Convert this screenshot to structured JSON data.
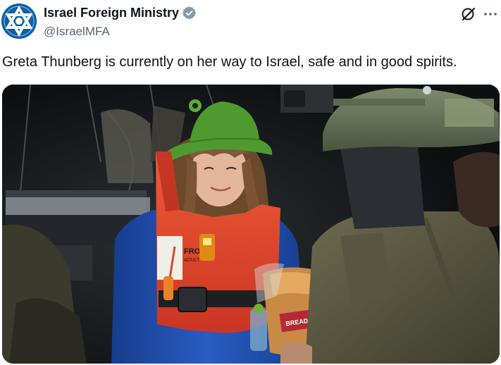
{
  "account": {
    "display_name": "Israel Foreign Ministry",
    "handle": "@IsraelMFA",
    "verified": true,
    "avatar_icon": "star-of-david-emblem-icon",
    "badge_color": "#829aab"
  },
  "header_actions": {
    "grok_icon": "grok-icon",
    "more_icon": "more-options-icon",
    "more_glyph": "···"
  },
  "tweet": {
    "text": "Greta Thunberg is currently on her way to Israel, safe and in good spirits."
  },
  "media": {
    "alt": "Photo of Greta Thunberg in a green bucket hat and orange life vest, holding a bag of bread, facing a soldier in a helmet",
    "vest_label_text": "FRO",
    "vest_label_sub": "ADULT",
    "bread_label": "BREAD",
    "colors": {
      "hat": "#4e9a2f",
      "vest": "#e2432c",
      "jacket": "#1f4fae",
      "background": "#141719"
    }
  }
}
